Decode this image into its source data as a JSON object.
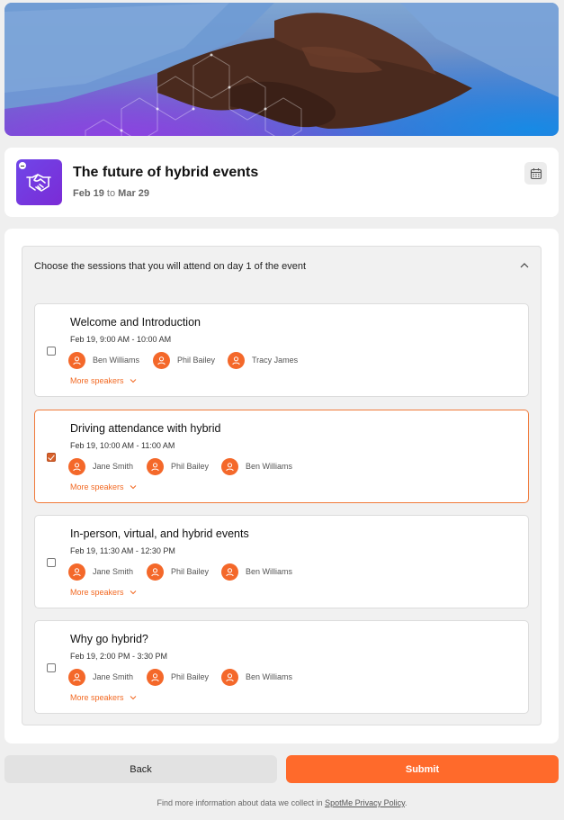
{
  "hero": {
    "image": "handshake-banner"
  },
  "event": {
    "title": "The future of hybrid events",
    "date_start": "Feb 19",
    "date_sep": "to",
    "date_end": "Mar 29",
    "logo_icon": "handshake-icon",
    "calendar_icon": "calendar-icon"
  },
  "accordion": {
    "header": "Choose the sessions that you will attend on day 1 of the event",
    "expanded": true
  },
  "sessions": [
    {
      "title": "Welcome and Introduction",
      "time": "Feb 19, 9:00 AM - 10:00 AM",
      "checked": false,
      "speakers": [
        "Ben Williams",
        "Phil Bailey",
        "Tracy James"
      ],
      "more_label": "More speakers"
    },
    {
      "title": "Driving attendance with hybrid",
      "time": "Feb 19, 10:00 AM - 11:00 AM",
      "checked": true,
      "speakers": [
        "Jane Smith",
        "Phil Bailey",
        "Ben Williams"
      ],
      "more_label": "More speakers"
    },
    {
      "title": "In-person, virtual, and hybrid events",
      "time": "Feb 19, 11:30 AM - 12:30 PM",
      "checked": false,
      "speakers": [
        "Jane Smith",
        "Phil Bailey",
        "Ben Williams"
      ],
      "more_label": "More speakers"
    },
    {
      "title": "Why go hybrid?",
      "time": "Feb 19, 2:00 PM - 3:30 PM",
      "checked": false,
      "speakers": [
        "Jane Smith",
        "Phil Bailey",
        "Ben Williams"
      ],
      "more_label": "More speakers"
    }
  ],
  "buttons": {
    "back": "Back",
    "submit": "Submit"
  },
  "footer": {
    "text": "Find more information about data we collect in",
    "link": "SpotMe Privacy Policy",
    "end": "."
  },
  "colors": {
    "accent": "#ff6a2b",
    "logo": "#6f46e8"
  }
}
